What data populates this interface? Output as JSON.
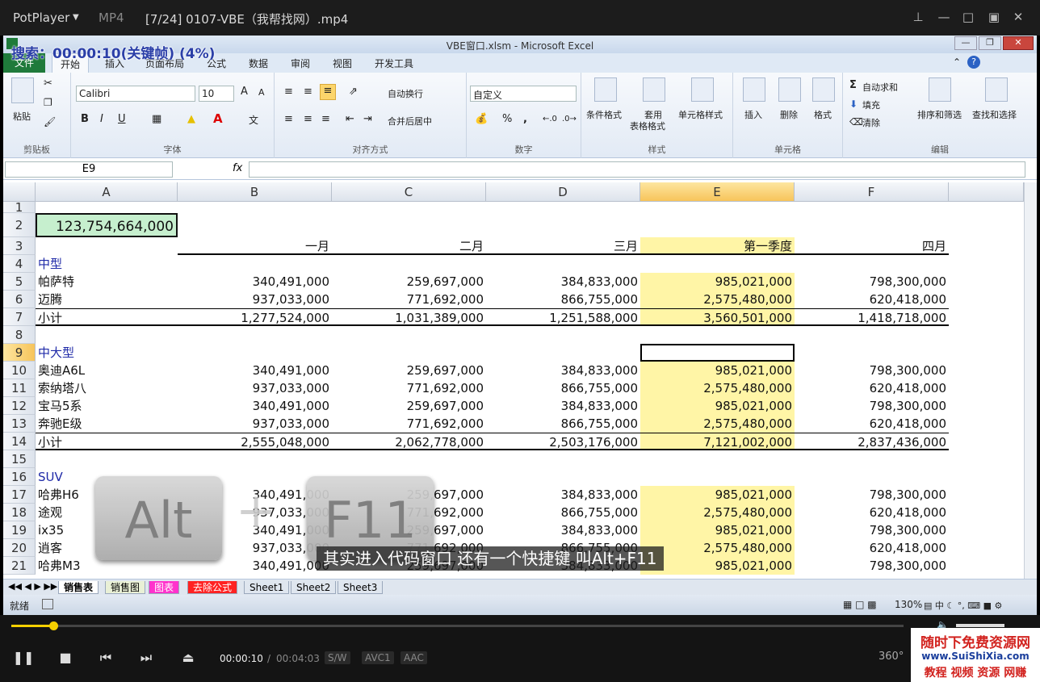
{
  "player": {
    "name": "PotPlayer",
    "format": "MP4",
    "file_title": "[7/24] 0107-VBE（我帮找网）.mp4",
    "seek_status": "搜索：00:00:10(关键帧) (4%)",
    "current_time": "00:00:10",
    "separator": "/",
    "total_time": "00:04:03",
    "badges": [
      "S/W",
      "AVC1",
      "AAC"
    ],
    "progress": 0.04,
    "icon_360": "360°"
  },
  "excel": {
    "title": "VBE窗口.xlsm - Microsoft Excel",
    "tabs": [
      "文件",
      "开始",
      "插入",
      "页面布局",
      "公式",
      "数据",
      "审阅",
      "视图",
      "开发工具"
    ],
    "ribbon": {
      "clipboard": {
        "paste": "粘贴",
        "label": "剪贴板"
      },
      "font": {
        "name": "Calibri",
        "size": "10",
        "label": "字体",
        "bold": "B",
        "italic": "I",
        "underline": "U",
        "grow": "A",
        "shrink": "A"
      },
      "align": {
        "wrap": "自动换行",
        "merge": "合并后居中",
        "label": "对齐方式"
      },
      "number": {
        "format": "自定义",
        "percent": "%",
        "comma": ",",
        "label": "数字"
      },
      "styles": {
        "cond": "条件格式",
        "table": "套用",
        "table2": "表格格式",
        "cell": "单元格样式",
        "label": "样式"
      },
      "cells": {
        "insert": "插入",
        "delete": "删除",
        "format": "格式",
        "label": "单元格"
      },
      "edit": {
        "autosum": "自动求和",
        "fill": "填充",
        "clear": "清除",
        "sort": "排序和筛选",
        "find": "查找和选择",
        "label": "编辑"
      }
    },
    "namebox": "E9",
    "fx": "fx",
    "columns": [
      "A",
      "B",
      "C",
      "D",
      "E",
      "F"
    ],
    "rows": [
      {
        "n": "1",
        "a": "",
        "v": [
          "",
          "",
          "",
          "",
          ""
        ]
      },
      {
        "n": "2",
        "a": "123,754,664,000",
        "v": [
          "",
          "",
          "",
          "",
          ""
        ]
      },
      {
        "n": "3",
        "a": "",
        "v": [
          "一月",
          "二月",
          "三月",
          "第一季度",
          "四月"
        ]
      },
      {
        "n": "4",
        "a": "中型",
        "v": [
          "",
          "",
          "",
          "",
          ""
        ]
      },
      {
        "n": "5",
        "a": "帕萨特",
        "v": [
          "340,491,000",
          "259,697,000",
          "384,833,000",
          "985,021,000",
          "798,300,000"
        ]
      },
      {
        "n": "6",
        "a": "迈腾",
        "v": [
          "937,033,000",
          "771,692,000",
          "866,755,000",
          "2,575,480,000",
          "620,418,000"
        ]
      },
      {
        "n": "7",
        "a": "小计",
        "v": [
          "1,277,524,000",
          "1,031,389,000",
          "1,251,588,000",
          "3,560,501,000",
          "1,418,718,000"
        ],
        "g": "1"
      },
      {
        "n": "8",
        "a": "",
        "v": [
          "",
          "",
          "",
          "",
          ""
        ]
      },
      {
        "n": "9",
        "a": "中大型",
        "v": [
          "",
          "",
          "",
          "",
          ""
        ]
      },
      {
        "n": "10",
        "a": "奥迪A6L",
        "v": [
          "340,491,000",
          "259,697,000",
          "384,833,000",
          "985,021,000",
          "798,300,000"
        ]
      },
      {
        "n": "11",
        "a": "索纳塔八",
        "v": [
          "937,033,000",
          "771,692,000",
          "866,755,000",
          "2,575,480,000",
          "620,418,000"
        ]
      },
      {
        "n": "12",
        "a": "宝马5系",
        "v": [
          "340,491,000",
          "259,697,000",
          "384,833,000",
          "985,021,000",
          "798,300,000"
        ]
      },
      {
        "n": "13",
        "a": "奔驰E级",
        "v": [
          "937,033,000",
          "771,692,000",
          "866,755,000",
          "2,575,480,000",
          "620,418,000"
        ]
      },
      {
        "n": "14",
        "a": "小计",
        "v": [
          "2,555,048,000",
          "2,062,778,000",
          "2,503,176,000",
          "7,121,002,000",
          "2,837,436,000"
        ],
        "g": "2"
      },
      {
        "n": "15",
        "a": "",
        "v": [
          "",
          "",
          "",
          "",
          ""
        ]
      },
      {
        "n": "16",
        "a": "SUV",
        "v": [
          "",
          "",
          "",
          "",
          ""
        ]
      },
      {
        "n": "17",
        "a": "哈弗H6",
        "v": [
          "340,491,000",
          "259,697,000",
          "384,833,000",
          "985,021,000",
          "798,300,000"
        ]
      },
      {
        "n": "18",
        "a": "途观",
        "v": [
          "937,033,000",
          "771,692,000",
          "866,755,000",
          "2,575,480,000",
          "620,418,000"
        ]
      },
      {
        "n": "19",
        "a": "ix35",
        "v": [
          "340,491,000",
          "259,697,000",
          "384,833,000",
          "985,021,000",
          "798,300,000"
        ]
      },
      {
        "n": "20",
        "a": "逍客",
        "v": [
          "937,033,000",
          "771,692,000",
          "866,755,000",
          "2,575,480,000",
          "620,418,000"
        ]
      },
      {
        "n": "21",
        "a": "哈弗M3",
        "v": [
          "340,491,000",
          "259,697,000",
          "384,833,000",
          "985,021,000",
          "798,300,000"
        ]
      }
    ],
    "sheets": [
      "销售表",
      "销售图",
      "图表",
      "去除公式",
      "Sheet1",
      "Sheet2",
      "Sheet3"
    ],
    "status": "就绪",
    "zoom": "130%"
  },
  "overlay": {
    "alt": "Alt",
    "plus": "+",
    "f11": "F11",
    "subtitle": "其实进入代码窗口 还有一个快捷键 叫Alt+F11"
  },
  "watermark": {
    "line1": "随时下免费资源网",
    "line2": "www.SuiShiXia.com",
    "line3": "教程 视频 资源 网赚"
  }
}
